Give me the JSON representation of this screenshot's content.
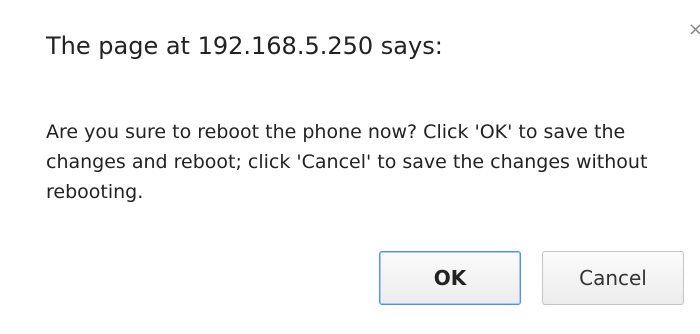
{
  "dialog": {
    "title": "The page at 192.168.5.250 says:",
    "close_glyph": "×",
    "message": "Are you sure to reboot the phone now? Click 'OK' to save the changes and reboot; click 'Cancel' to save the changes without rebooting.",
    "ok_label": "OK",
    "cancel_label": "Cancel",
    "icons": {
      "close": "close-icon"
    },
    "colors": {
      "focus_border": "#4d90fe",
      "text": "#222222"
    }
  }
}
